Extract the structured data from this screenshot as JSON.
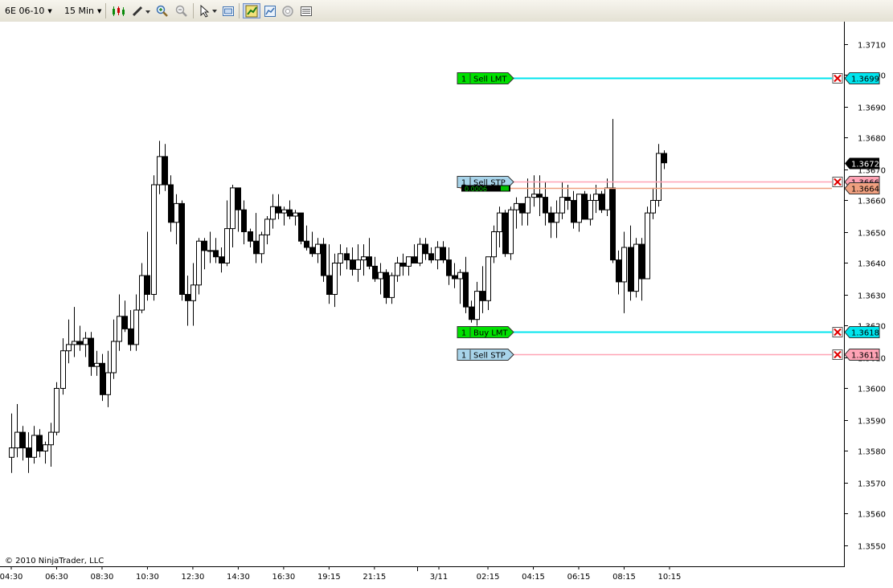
{
  "toolbar": {
    "instrument": "6E 06-10",
    "interval": "15 Min",
    "icons": [
      "candlestick-style-icon",
      "draw-pencil-icon",
      "zoom-in-icon",
      "zoom-out-icon",
      "pointer-icon",
      "properties-icon",
      "chart-trader-icon",
      "strategy-icon",
      "indicator-icon",
      "data-box-icon"
    ]
  },
  "copyright": "© 2010 NinjaTrader, LLC",
  "colors": {
    "limit_line": "#00e5ee",
    "stop_line": "#ffa3b5",
    "position_line": "#f0a080",
    "limit_tag": "#00e000",
    "stop_tag": "#a8d4ea",
    "price_badge": "#000000"
  },
  "chart_data": {
    "type": "candlestick",
    "ylim": [
      1.3545,
      1.372
    ],
    "y_ticks": [
      "1.3550",
      "1.3560",
      "1.3570",
      "1.3580",
      "1.3590",
      "1.3600",
      "1.3610",
      "1.3620",
      "1.3630",
      "1.3640",
      "1.3650",
      "1.3660",
      "1.3670",
      "1.3680",
      "1.3690",
      "1.3700",
      "1.3710"
    ],
    "x_ticks": [
      "04:30",
      "06:30",
      "08:30",
      "10:30",
      "12:30",
      "14:30",
      "16:30",
      "19:15",
      "21:15",
      "3/11",
      "02:15",
      "04:15",
      "06:15",
      "08:15",
      "10:15"
    ],
    "candles": [
      {
        "o": 1.3578,
        "h": 1.3592,
        "l": 1.3573,
        "c": 1.3581
      },
      {
        "o": 1.3581,
        "h": 1.3595,
        "l": 1.3578,
        "c": 1.3586
      },
      {
        "o": 1.3586,
        "h": 1.3588,
        "l": 1.3577,
        "c": 1.3581
      },
      {
        "o": 1.3581,
        "h": 1.3586,
        "l": 1.3573,
        "c": 1.3578
      },
      {
        "o": 1.3578,
        "h": 1.3588,
        "l": 1.3576,
        "c": 1.3585
      },
      {
        "o": 1.3585,
        "h": 1.3587,
        "l": 1.3578,
        "c": 1.358
      },
      {
        "o": 1.358,
        "h": 1.3583,
        "l": 1.3576,
        "c": 1.3582
      },
      {
        "o": 1.3582,
        "h": 1.3589,
        "l": 1.3575,
        "c": 1.3586
      },
      {
        "o": 1.3586,
        "h": 1.3602,
        "l": 1.3585,
        "c": 1.36
      },
      {
        "o": 1.36,
        "h": 1.3616,
        "l": 1.3598,
        "c": 1.3612
      },
      {
        "o": 1.3612,
        "h": 1.3622,
        "l": 1.3608,
        "c": 1.3614
      },
      {
        "o": 1.3614,
        "h": 1.3626,
        "l": 1.361,
        "c": 1.3615
      },
      {
        "o": 1.3615,
        "h": 1.362,
        "l": 1.3612,
        "c": 1.3614
      },
      {
        "o": 1.3614,
        "h": 1.3618,
        "l": 1.361,
        "c": 1.3616
      },
      {
        "o": 1.3616,
        "h": 1.3618,
        "l": 1.3604,
        "c": 1.3607
      },
      {
        "o": 1.3607,
        "h": 1.3612,
        "l": 1.3604,
        "c": 1.3608
      },
      {
        "o": 1.3608,
        "h": 1.3611,
        "l": 1.3596,
        "c": 1.3598
      },
      {
        "o": 1.3598,
        "h": 1.3612,
        "l": 1.3594,
        "c": 1.3605
      },
      {
        "o": 1.3605,
        "h": 1.3622,
        "l": 1.3603,
        "c": 1.3615
      },
      {
        "o": 1.3615,
        "h": 1.363,
        "l": 1.3612,
        "c": 1.3623
      },
      {
        "o": 1.3623,
        "h": 1.3628,
        "l": 1.3618,
        "c": 1.3619
      },
      {
        "o": 1.3619,
        "h": 1.3625,
        "l": 1.3612,
        "c": 1.3614
      },
      {
        "o": 1.3614,
        "h": 1.363,
        "l": 1.3612,
        "c": 1.3625
      },
      {
        "o": 1.3625,
        "h": 1.364,
        "l": 1.3624,
        "c": 1.3636
      },
      {
        "o": 1.3636,
        "h": 1.365,
        "l": 1.3628,
        "c": 1.363
      },
      {
        "o": 1.363,
        "h": 1.3668,
        "l": 1.3628,
        "c": 1.3665
      },
      {
        "o": 1.3665,
        "h": 1.3679,
        "l": 1.3662,
        "c": 1.3674
      },
      {
        "o": 1.3674,
        "h": 1.3678,
        "l": 1.3663,
        "c": 1.3665
      },
      {
        "o": 1.3665,
        "h": 1.3668,
        "l": 1.365,
        "c": 1.3653
      },
      {
        "o": 1.3653,
        "h": 1.3662,
        "l": 1.3646,
        "c": 1.3659
      },
      {
        "o": 1.3659,
        "h": 1.366,
        "l": 1.3628,
        "c": 1.363
      },
      {
        "o": 1.363,
        "h": 1.3636,
        "l": 1.362,
        "c": 1.3628
      },
      {
        "o": 1.3628,
        "h": 1.364,
        "l": 1.362,
        "c": 1.3633
      },
      {
        "o": 1.3633,
        "h": 1.3648,
        "l": 1.363,
        "c": 1.3647
      },
      {
        "o": 1.3647,
        "h": 1.3648,
        "l": 1.3638,
        "c": 1.3644
      },
      {
        "o": 1.3644,
        "h": 1.365,
        "l": 1.364,
        "c": 1.3644
      },
      {
        "o": 1.3644,
        "h": 1.3648,
        "l": 1.364,
        "c": 1.3642
      },
      {
        "o": 1.3642,
        "h": 1.3645,
        "l": 1.3637,
        "c": 1.364
      },
      {
        "o": 1.364,
        "h": 1.366,
        "l": 1.3639,
        "c": 1.3651
      },
      {
        "o": 1.3651,
        "h": 1.3665,
        "l": 1.3645,
        "c": 1.3664
      },
      {
        "o": 1.3664,
        "h": 1.3663,
        "l": 1.365,
        "c": 1.3657
      },
      {
        "o": 1.3657,
        "h": 1.366,
        "l": 1.3646,
        "c": 1.365
      },
      {
        "o": 1.365,
        "h": 1.3651,
        "l": 1.3645,
        "c": 1.3647
      },
      {
        "o": 1.3647,
        "h": 1.3656,
        "l": 1.364,
        "c": 1.3643
      },
      {
        "o": 1.3643,
        "h": 1.365,
        "l": 1.364,
        "c": 1.3649
      },
      {
        "o": 1.3649,
        "h": 1.3655,
        "l": 1.3646,
        "c": 1.3654
      },
      {
        "o": 1.3654,
        "h": 1.3662,
        "l": 1.3651,
        "c": 1.3658
      },
      {
        "o": 1.3658,
        "h": 1.3662,
        "l": 1.3654,
        "c": 1.3656
      },
      {
        "o": 1.3656,
        "h": 1.3658,
        "l": 1.3652,
        "c": 1.3657
      },
      {
        "o": 1.3657,
        "h": 1.366,
        "l": 1.3654,
        "c": 1.3655
      },
      {
        "o": 1.3655,
        "h": 1.3657,
        "l": 1.3652,
        "c": 1.3656
      },
      {
        "o": 1.3656,
        "h": 1.3655,
        "l": 1.3646,
        "c": 1.3647
      },
      {
        "o": 1.3647,
        "h": 1.3652,
        "l": 1.3644,
        "c": 1.3645
      },
      {
        "o": 1.3645,
        "h": 1.365,
        "l": 1.3642,
        "c": 1.3643
      },
      {
        "o": 1.3643,
        "h": 1.3648,
        "l": 1.364,
        "c": 1.3646
      },
      {
        "o": 1.3646,
        "h": 1.3648,
        "l": 1.3634,
        "c": 1.3636
      },
      {
        "o": 1.3636,
        "h": 1.3646,
        "l": 1.3627,
        "c": 1.363
      },
      {
        "o": 1.363,
        "h": 1.3643,
        "l": 1.3626,
        "c": 1.364
      },
      {
        "o": 1.364,
        "h": 1.3646,
        "l": 1.3636,
        "c": 1.3643
      },
      {
        "o": 1.3643,
        "h": 1.3645,
        "l": 1.3638,
        "c": 1.3641
      },
      {
        "o": 1.3641,
        "h": 1.3645,
        "l": 1.3636,
        "c": 1.3638
      },
      {
        "o": 1.3638,
        "h": 1.3646,
        "l": 1.3634,
        "c": 1.3641
      },
      {
        "o": 1.3641,
        "h": 1.3646,
        "l": 1.3636,
        "c": 1.3642
      },
      {
        "o": 1.3642,
        "h": 1.3648,
        "l": 1.3638,
        "c": 1.3639
      },
      {
        "o": 1.3639,
        "h": 1.3642,
        "l": 1.3634,
        "c": 1.3635
      },
      {
        "o": 1.3635,
        "h": 1.364,
        "l": 1.363,
        "c": 1.3637
      },
      {
        "o": 1.3637,
        "h": 1.3638,
        "l": 1.3627,
        "c": 1.3629
      },
      {
        "o": 1.3629,
        "h": 1.3637,
        "l": 1.3627,
        "c": 1.3636
      },
      {
        "o": 1.3636,
        "h": 1.3642,
        "l": 1.3634,
        "c": 1.364
      },
      {
        "o": 1.364,
        "h": 1.3643,
        "l": 1.3636,
        "c": 1.3639
      },
      {
        "o": 1.3639,
        "h": 1.3641,
        "l": 1.3636,
        "c": 1.3642
      },
      {
        "o": 1.3642,
        "h": 1.3646,
        "l": 1.364,
        "c": 1.364
      },
      {
        "o": 1.364,
        "h": 1.3648,
        "l": 1.3639,
        "c": 1.3646
      },
      {
        "o": 1.3646,
        "h": 1.3648,
        "l": 1.3641,
        "c": 1.3643
      },
      {
        "o": 1.3643,
        "h": 1.3645,
        "l": 1.364,
        "c": 1.3641
      },
      {
        "o": 1.3641,
        "h": 1.3647,
        "l": 1.3638,
        "c": 1.3645
      },
      {
        "o": 1.3645,
        "h": 1.3647,
        "l": 1.364,
        "c": 1.3641
      },
      {
        "o": 1.3641,
        "h": 1.3645,
        "l": 1.3633,
        "c": 1.3636
      },
      {
        "o": 1.3636,
        "h": 1.364,
        "l": 1.3632,
        "c": 1.3635
      },
      {
        "o": 1.3635,
        "h": 1.3638,
        "l": 1.3627,
        "c": 1.3637
      },
      {
        "o": 1.3637,
        "h": 1.3642,
        "l": 1.3624,
        "c": 1.3626
      },
      {
        "o": 1.3626,
        "h": 1.3628,
        "l": 1.3621,
        "c": 1.3622
      },
      {
        "o": 1.3622,
        "h": 1.3634,
        "l": 1.362,
        "c": 1.3631
      },
      {
        "o": 1.3631,
        "h": 1.3639,
        "l": 1.3624,
        "c": 1.3628
      },
      {
        "o": 1.3628,
        "h": 1.364,
        "l": 1.3625,
        "c": 1.3642
      },
      {
        "o": 1.3642,
        "h": 1.3652,
        "l": 1.364,
        "c": 1.365
      },
      {
        "o": 1.365,
        "h": 1.3658,
        "l": 1.3645,
        "c": 1.3656
      },
      {
        "o": 1.3656,
        "h": 1.3657,
        "l": 1.3642,
        "c": 1.3643
      },
      {
        "o": 1.3643,
        "h": 1.3658,
        "l": 1.3641,
        "c": 1.3657
      },
      {
        "o": 1.3657,
        "h": 1.3661,
        "l": 1.3651,
        "c": 1.3659
      },
      {
        "o": 1.3659,
        "h": 1.3658,
        "l": 1.3652,
        "c": 1.3656
      },
      {
        "o": 1.3656,
        "h": 1.3667,
        "l": 1.3652,
        "c": 1.3661
      },
      {
        "o": 1.3661,
        "h": 1.3668,
        "l": 1.3658,
        "c": 1.3662
      },
      {
        "o": 1.3662,
        "h": 1.3668,
        "l": 1.3655,
        "c": 1.3661
      },
      {
        "o": 1.3661,
        "h": 1.3666,
        "l": 1.3652,
        "c": 1.3656
      },
      {
        "o": 1.3656,
        "h": 1.3658,
        "l": 1.3648,
        "c": 1.3653
      },
      {
        "o": 1.3653,
        "h": 1.366,
        "l": 1.3648,
        "c": 1.3656
      },
      {
        "o": 1.3656,
        "h": 1.3666,
        "l": 1.3654,
        "c": 1.3661
      },
      {
        "o": 1.3661,
        "h": 1.3665,
        "l": 1.3657,
        "c": 1.366
      },
      {
        "o": 1.366,
        "h": 1.3663,
        "l": 1.3651,
        "c": 1.3653
      },
      {
        "o": 1.3653,
        "h": 1.3662,
        "l": 1.365,
        "c": 1.3662
      },
      {
        "o": 1.3662,
        "h": 1.3663,
        "l": 1.3655,
        "c": 1.3654
      },
      {
        "o": 1.3654,
        "h": 1.3662,
        "l": 1.3652,
        "c": 1.366
      },
      {
        "o": 1.366,
        "h": 1.3665,
        "l": 1.3656,
        "c": 1.3662
      },
      {
        "o": 1.3662,
        "h": 1.3663,
        "l": 1.3656,
        "c": 1.3657
      },
      {
        "o": 1.3657,
        "h": 1.3667,
        "l": 1.3655,
        "c": 1.3664
      },
      {
        "o": 1.3664,
        "h": 1.3686,
        "l": 1.364,
        "c": 1.3641
      },
      {
        "o": 1.3641,
        "h": 1.3644,
        "l": 1.363,
        "c": 1.3634
      },
      {
        "o": 1.3634,
        "h": 1.365,
        "l": 1.3624,
        "c": 1.3645
      },
      {
        "o": 1.3645,
        "h": 1.3652,
        "l": 1.3628,
        "c": 1.3631
      },
      {
        "o": 1.3631,
        "h": 1.3648,
        "l": 1.3629,
        "c": 1.3646
      },
      {
        "o": 1.3646,
        "h": 1.3648,
        "l": 1.3628,
        "c": 1.3635
      },
      {
        "o": 1.3635,
        "h": 1.3658,
        "l": 1.3635,
        "c": 1.3656
      },
      {
        "o": 1.3656,
        "h": 1.3664,
        "l": 1.3654,
        "c": 1.366
      },
      {
        "o": 1.366,
        "h": 1.3678,
        "l": 1.3658,
        "c": 1.3675
      },
      {
        "o": 1.3675,
        "h": 1.3676,
        "l": 1.367,
        "c": 1.3672
      }
    ],
    "orders": [
      {
        "qty": "1",
        "label": "Sell LMT",
        "price": "1.3699",
        "value": 1.3699,
        "kind": "limit"
      },
      {
        "qty": "1",
        "label": "Sell STP",
        "price": "1.3666",
        "value": 1.3666,
        "kind": "stop"
      },
      {
        "qty": "1",
        "label": "Buy LMT",
        "price": "1.3618",
        "value": 1.3618,
        "kind": "limit"
      },
      {
        "qty": "1",
        "label": "Sell STP",
        "price": "1.3611",
        "value": 1.3611,
        "kind": "stop"
      }
    ],
    "position": {
      "price": "1.3664",
      "value": 1.3664,
      "pnl": "0.0006"
    },
    "last_price": {
      "price": "1.3672",
      "value": 1.3672
    }
  }
}
